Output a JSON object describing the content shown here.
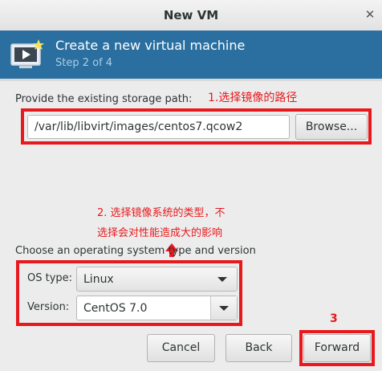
{
  "window": {
    "title": "New VM",
    "close_glyph": "✕"
  },
  "banner": {
    "heading": "Create a new virtual machine",
    "step": "Step 2 of 4",
    "icon": "vm-monitor-icon"
  },
  "storage": {
    "label": "Provide the existing storage path:",
    "path_value": "/var/lib/libvirt/images/centos7.qcow2",
    "browse_label": "Browse..."
  },
  "os": {
    "label": "Choose an operating system type and version",
    "type_label": "OS type:",
    "type_value": "Linux",
    "version_label": "Version:",
    "version_value": "CentOS 7.0"
  },
  "annotations": {
    "note1": "1.选择镜像的路径",
    "note2_line1": "2. 选择镜像系统的类型，不",
    "note2_line2": "选择会对性能造成大的影响",
    "note3": "3",
    "color": "#e8191d"
  },
  "buttons": {
    "cancel": "Cancel",
    "back": "Back",
    "forward": "Forward"
  }
}
